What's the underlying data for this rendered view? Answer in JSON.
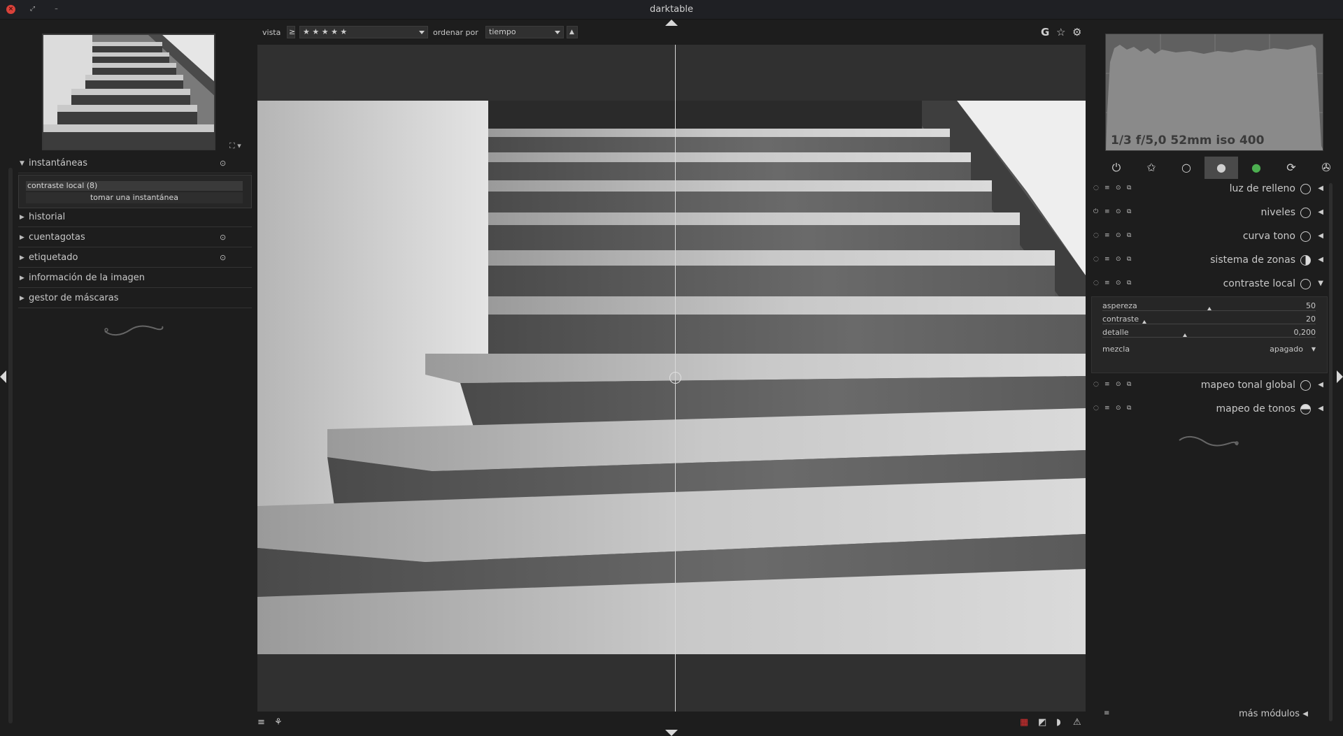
{
  "window": {
    "title": "darktable"
  },
  "left": {
    "sections": [
      {
        "label": "instantáneas",
        "expanded": true,
        "has_gear": true
      },
      {
        "label": "historial",
        "expanded": false,
        "has_gear": false
      },
      {
        "label": "cuentagotas",
        "expanded": false,
        "has_gear": true
      },
      {
        "label": "etiquetado",
        "expanded": false,
        "has_gear": true
      },
      {
        "label": "información de la imagen",
        "expanded": false,
        "has_gear": false
      },
      {
        "label": "gestor de máscaras",
        "expanded": false,
        "has_gear": false
      }
    ],
    "snapshot_item": "contraste local (8)",
    "take_snapshot": "tomar una instantánea"
  },
  "filterbar": {
    "view_label": "vista",
    "comparator": "≥",
    "rating": "★ ★ ★ ★ ★",
    "sort_label": "ordenar por",
    "sort_value": "tiempo",
    "sort_dir": "▲",
    "g_icon": "G"
  },
  "histogram": {
    "info": "1/3 f/5,0 52mm iso 400"
  },
  "modules": [
    {
      "name": "luz de relleno",
      "state": "collapsed",
      "icon": "fill-light-icon"
    },
    {
      "name": "niveles",
      "state": "collapsed",
      "icon": "levels-icon"
    },
    {
      "name": "curva tono",
      "state": "collapsed",
      "icon": "tone-curve-icon"
    },
    {
      "name": "sistema de zonas",
      "state": "collapsed",
      "icon": "zone-system-icon"
    },
    {
      "name": "contraste local",
      "state": "expanded",
      "icon": "local-contrast-icon"
    },
    {
      "name": "mapeo tonal global",
      "state": "collapsed",
      "icon": "global-tonemap-icon"
    },
    {
      "name": "mapeo de tonos",
      "state": "collapsed",
      "icon": "tonemap-icon"
    }
  ],
  "local_contrast": {
    "params": [
      {
        "label": "aspereza",
        "value": "50",
        "level": 0.5
      },
      {
        "label": "contraste",
        "value": "20",
        "level": 0.15
      },
      {
        "label": "detalle",
        "value": "0,200",
        "level": 0.4
      }
    ],
    "blend_label": "mezcla",
    "blend_value": "apagado"
  },
  "more_modules": "más módulos"
}
